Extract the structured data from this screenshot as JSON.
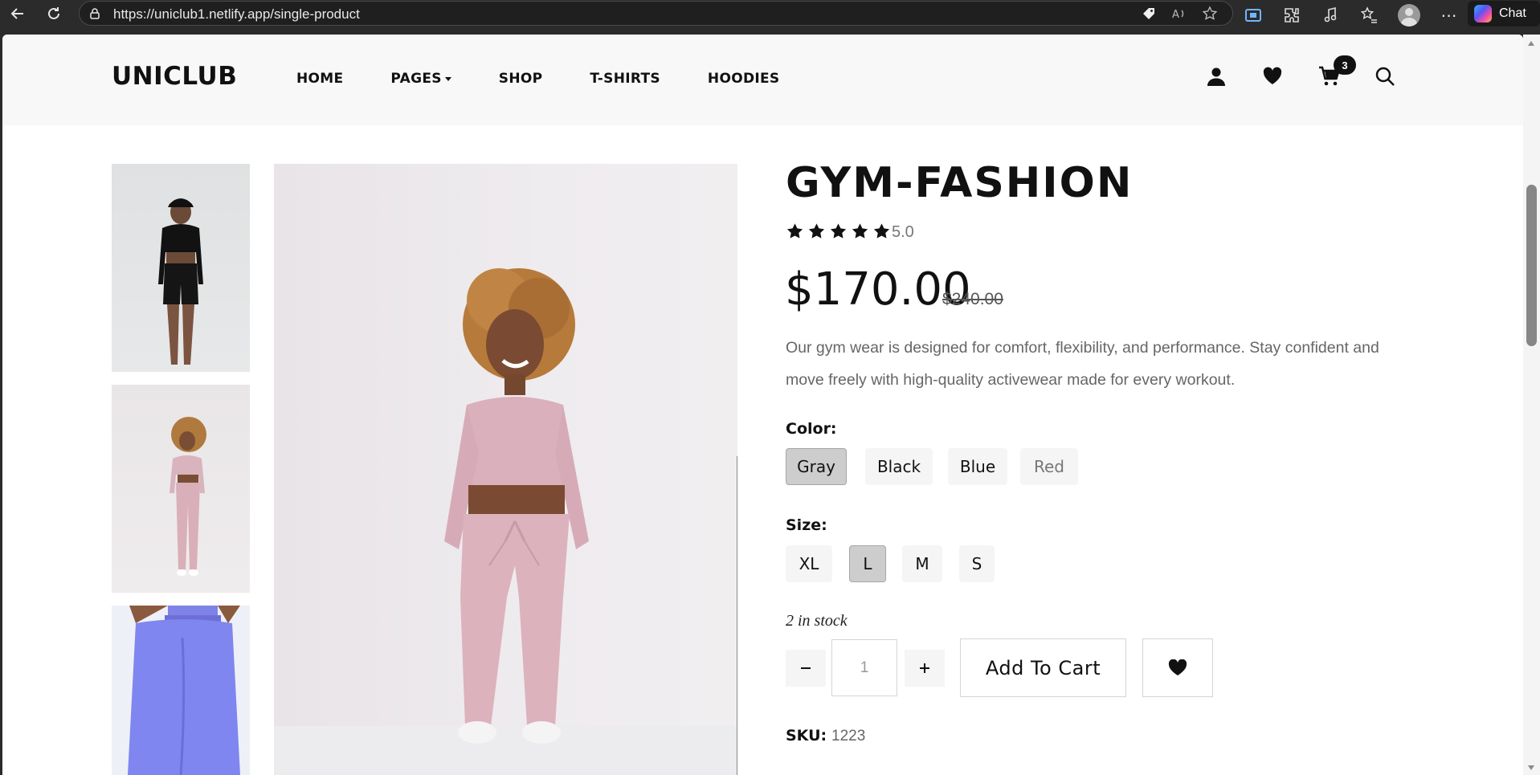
{
  "browser": {
    "url": "https://uniclub1.netlify.app/single-product",
    "chat_label": "Chat"
  },
  "header": {
    "logo": "UNICLUB",
    "nav": [
      {
        "label": "HOME"
      },
      {
        "label": "PAGES"
      },
      {
        "label": "SHOP"
      },
      {
        "label": "T-SHIRTS"
      },
      {
        "label": "HOODIES"
      }
    ],
    "cart_count": "3",
    "icons": [
      "user-icon",
      "heart-icon",
      "cart-icon",
      "search-icon"
    ]
  },
  "product": {
    "title": "GYM-FASHION",
    "rating": 5,
    "rating_text": "5.0",
    "price": "$170.00",
    "old_price": "$240.00",
    "description": "Our gym wear is designed for comfort, flexibility, and performance. Stay confident and move freely with high-quality activewear made for every workout.",
    "color_label": "Color:",
    "colors": [
      {
        "label": "Gray",
        "selected": true
      },
      {
        "label": "Black",
        "selected": false
      },
      {
        "label": "Blue",
        "selected": false
      },
      {
        "label": "Red",
        "selected": false
      }
    ],
    "size_label": "Size:",
    "sizes": [
      {
        "label": "XL",
        "selected": false
      },
      {
        "label": "L",
        "selected": true
      },
      {
        "label": "M",
        "selected": false
      },
      {
        "label": "S",
        "selected": false
      }
    ],
    "stock": "2 in stock",
    "quantity": "1",
    "add_to_cart": "Add To Cart",
    "sku_label": "SKU:",
    "sku": "1223"
  },
  "colors": {
    "text_dark": "#111111",
    "muted": "#666666",
    "header_bg": "#f8f8f8",
    "selected_option": "#cdcdcd"
  }
}
